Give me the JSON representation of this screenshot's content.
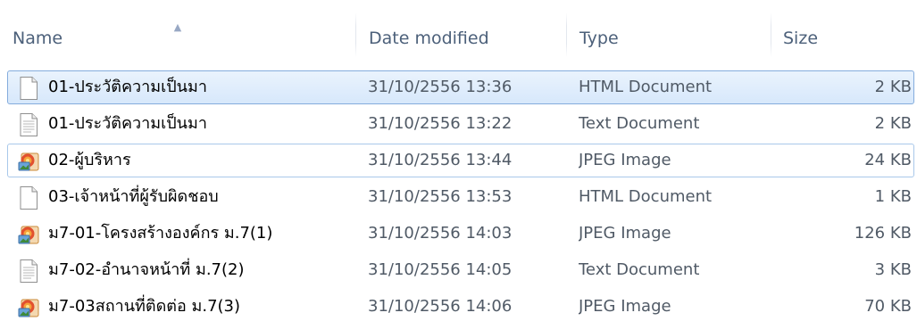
{
  "header": {
    "columns": {
      "name": "Name",
      "date": "Date modified",
      "type": "Type",
      "size": "Size"
    },
    "sort_column": "name",
    "sort_direction": "ascending"
  },
  "files": [
    {
      "name": "01-ประวัติความเป็นมา",
      "date": "31/10/2556 13:36",
      "type": "HTML Document",
      "size": "2 KB",
      "icon": "html-document-icon",
      "state": "selected"
    },
    {
      "name": "01-ประวัติความเป็นมา",
      "date": "31/10/2556 13:22",
      "type": "Text Document",
      "size": "2 KB",
      "icon": "text-document-icon",
      "state": "normal"
    },
    {
      "name": "02-ผู้บริหาร",
      "date": "31/10/2556 13:44",
      "type": "JPEG Image",
      "size": "24 KB",
      "icon": "jpeg-image-icon",
      "state": "focused"
    },
    {
      "name": "03-เจ้าหน้าที่ผู้รับผิดชอบ",
      "date": "31/10/2556 13:53",
      "type": "HTML Document",
      "size": "1 KB",
      "icon": "html-document-icon",
      "state": "normal"
    },
    {
      "name": "ม7-01-โครงสร้างองค์กร ม.7(1)",
      "date": "31/10/2556 14:03",
      "type": "JPEG Image",
      "size": "126 KB",
      "icon": "jpeg-image-icon",
      "state": "normal"
    },
    {
      "name": "ม7-02-อำนาจหน้าที่ ม.7(2)",
      "date": "31/10/2556 14:05",
      "type": "Text Document",
      "size": "3 KB",
      "icon": "text-document-icon",
      "state": "normal"
    },
    {
      "name": "ม7-03สถานที่ติดต่อ ม.7(3)",
      "date": "31/10/2556 14:06",
      "type": "JPEG Image",
      "size": "70 KB",
      "icon": "jpeg-image-icon",
      "state": "normal"
    }
  ]
}
